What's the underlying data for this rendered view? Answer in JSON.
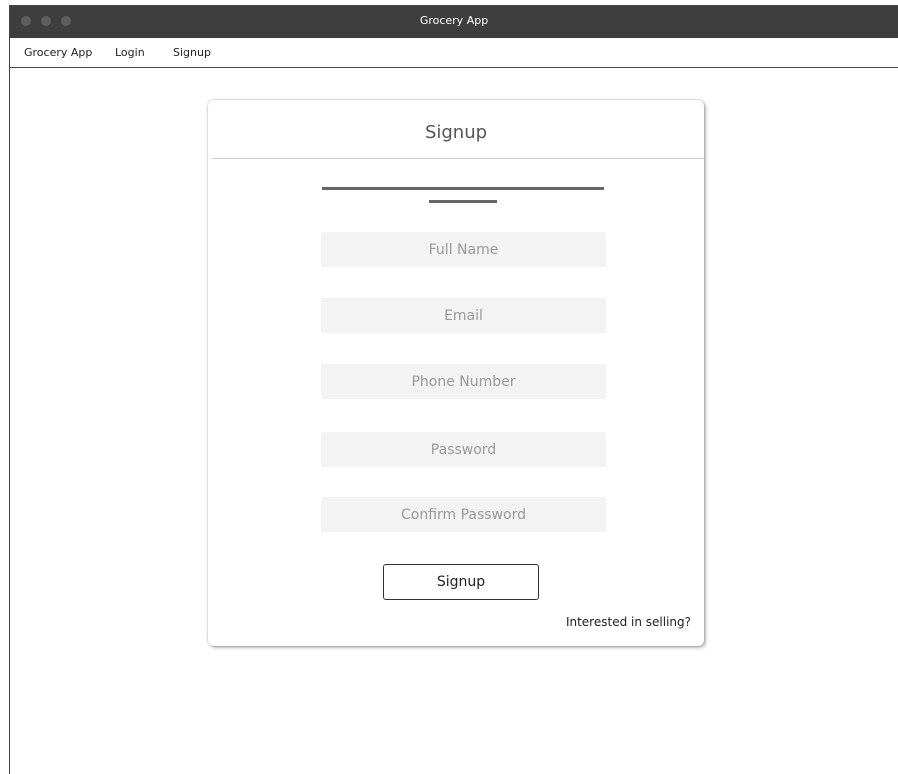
{
  "window": {
    "title": "Grocery App"
  },
  "menubar": {
    "items": [
      {
        "label": "Grocery App"
      },
      {
        "label": "Login"
      },
      {
        "label": "Signup"
      }
    ]
  },
  "signup_card": {
    "title": "Signup",
    "fields": [
      {
        "placeholder": "Full Name",
        "value": ""
      },
      {
        "placeholder": "Email",
        "value": ""
      },
      {
        "placeholder": "Phone Number",
        "value": ""
      },
      {
        "placeholder": "Password",
        "value": ""
      },
      {
        "placeholder": "Confirm Password",
        "value": ""
      }
    ],
    "submit_label": "Signup",
    "sell_link": "Interested in selling?"
  }
}
